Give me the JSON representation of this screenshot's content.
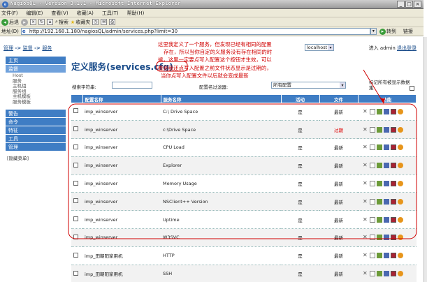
{
  "window": {
    "title": "NagiosQL - Version 3.1.1 - Microsoft Internet Explorer",
    "buttons": [
      "_",
      "□",
      "×"
    ]
  },
  "menu": [
    "文件(F)",
    "编辑(E)",
    "查看(V)",
    "收藏(A)",
    "工具(T)",
    "帮助(H)"
  ],
  "toolbar": {
    "back": "后退",
    "search": "搜索",
    "favorites": "收藏夹"
  },
  "address": {
    "label": "地址(D)",
    "url": "http://192.168.1.180/nagiosQL/admin/services.php?limit=30",
    "go": "转到",
    "links": "链接"
  },
  "breadcrumb": {
    "manage": "管理",
    "monitor": "监督",
    "services": "服务",
    "sep": " -> "
  },
  "host_select": "localhost",
  "login": {
    "prefix": "进入",
    "user": "admin",
    "logout": "退出登录"
  },
  "sidebar": {
    "items": [
      {
        "label": "主页",
        "active": false
      },
      {
        "label": "监督",
        "active": true
      }
    ],
    "subitems": [
      "Host",
      "服务",
      "主机组",
      "服务组",
      "主机模板",
      "服务模板"
    ],
    "more_items": [
      "警告",
      "命令",
      "特征",
      "工具",
      "管理"
    ],
    "hide_menu": "[隐藏菜单]"
  },
  "page": {
    "title": "定义服务(services.cfg)"
  },
  "search": {
    "label": "搜索字符串:",
    "value": ""
  },
  "filter": {
    "label": "配置名过滤器:",
    "value": "所有配置"
  },
  "mark_all": {
    "label": "标记所有被显示数据集"
  },
  "table": {
    "headers": [
      "",
      "配置名称",
      "服务名称",
      "活动",
      "文件",
      "功能"
    ],
    "rows": [
      {
        "config": "imp_winserver",
        "service": "C:\\ Drive Space",
        "active": "是",
        "file": "最新",
        "expired": false
      },
      {
        "config": "imp_winserver",
        "service": "c:\\Drive Space",
        "active": "是",
        "file": "过期",
        "expired": true
      },
      {
        "config": "imp_winserver",
        "service": "CPU Load",
        "active": "是",
        "file": "最新",
        "expired": false
      },
      {
        "config": "imp_winserver",
        "service": "Explorer",
        "active": "是",
        "file": "最新",
        "expired": false
      },
      {
        "config": "imp_winserver",
        "service": "Memory Usage",
        "active": "是",
        "file": "最新",
        "expired": false
      },
      {
        "config": "imp_winserver",
        "service": "NSClient++ Version",
        "active": "是",
        "file": "最新",
        "expired": false
      },
      {
        "config": "imp_winserver",
        "service": "Uptime",
        "active": "是",
        "file": "最新",
        "expired": false
      },
      {
        "config": "imp_winserver",
        "service": "W3SVC",
        "active": "是",
        "file": "最新",
        "expired": false
      },
      {
        "config": "imp_田朝阳家用机",
        "service": "HTTP",
        "active": "是",
        "file": "最新",
        "expired": false
      },
      {
        "config": "imp_田朝阳家用机",
        "service": "SSH",
        "active": "是",
        "file": "最新",
        "expired": false
      }
    ]
  },
  "annotation": {
    "lines": [
      "这里我定义了一个服务，但发现已经有相同的配置",
      "存在，所以当你自定的义服务没有存在相同的时",
      "候，这里一定要点写入配置这个按钮才生效，可以",
      "看到我还点写入配置之前文件状态显示是过期的，",
      "当你点写入配置文件以后就会变成最新"
    ],
    "color": "#d00000"
  },
  "colors": {
    "header_blue": "#3f7dc4",
    "title_blue": "#1a4c8a",
    "expired_red": "#dd0000"
  }
}
